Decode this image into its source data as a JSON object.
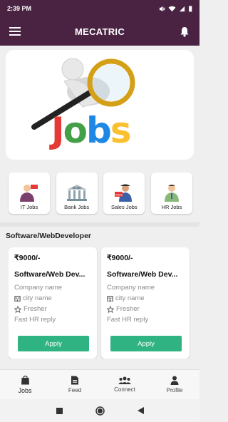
{
  "status_bar": {
    "time": "2:39 PM",
    "battery": "▮"
  },
  "app_bar": {
    "title": "MECATRIC",
    "menu_icon": "menu-icon",
    "notification_icon": "bell-icon"
  },
  "banner": {
    "word": "Jobs",
    "colors": [
      "#e53935",
      "#43a047",
      "#1e88e5",
      "#fbc02d"
    ]
  },
  "categories": [
    {
      "label": "IT Jobs",
      "icon": "it-jobs-icon"
    },
    {
      "label": "Bank Jobs",
      "icon": "bank-icon",
      "sign": "BANK"
    },
    {
      "label": "Sales Jobs",
      "icon": "sales-icon",
      "sign": "SALE"
    },
    {
      "label": "HR Jobs",
      "icon": "hr-icon"
    }
  ],
  "section": {
    "title": "Software/WebDeveloper"
  },
  "jobs": [
    {
      "salary": "₹9000/-",
      "title": "Software/Web Dev...",
      "company": "Company name",
      "city": "city name",
      "experience": "Fresher",
      "reply": "Fast HR reply",
      "apply_label": "Apply"
    },
    {
      "salary": "₹9000/-",
      "title": "Software/Web Dev...",
      "company": "Company name",
      "city": "city name",
      "experience": "Fresher",
      "reply": "Fast HR reply",
      "apply_label": "Apply"
    }
  ],
  "bottom_nav": [
    {
      "label": "Jobs",
      "icon": "jobs-bag-icon",
      "active": true
    },
    {
      "label": "Feed",
      "icon": "feed-icon",
      "active": false
    },
    {
      "label": "Connect",
      "icon": "connect-icon",
      "active": false
    },
    {
      "label": "Profile",
      "icon": "profile-icon",
      "active": false
    }
  ],
  "accent_colors": {
    "primary": "#4a2343",
    "apply": "#2fb383"
  }
}
